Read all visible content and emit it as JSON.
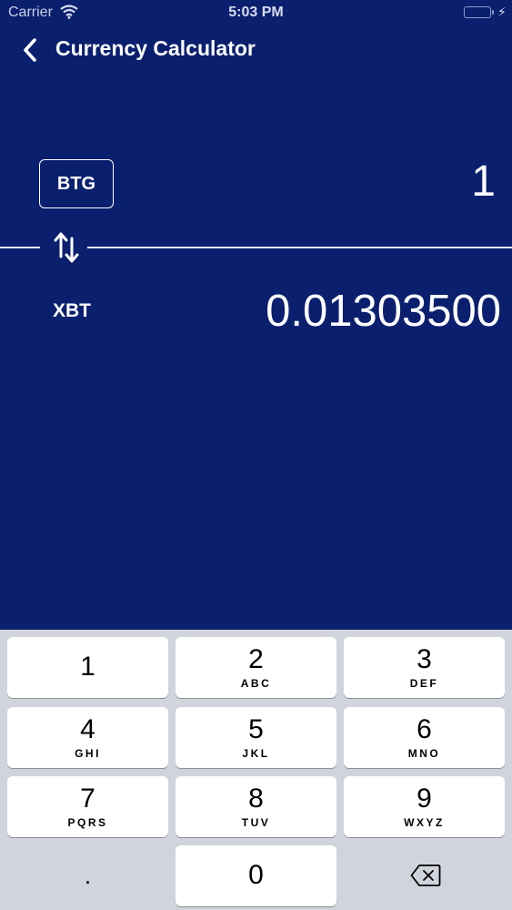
{
  "status_bar": {
    "carrier": "Carrier",
    "time": "5:03 PM",
    "battery_level": 1.0,
    "battery_color": "#4cd964"
  },
  "nav": {
    "title": "Currency Calculator",
    "back_icon": "chevron-left-icon"
  },
  "converter": {
    "from_code": "BTG",
    "from_amount": "1",
    "to_code": "XBT",
    "to_amount": "0.01303500",
    "swap_icon": "swap-arrows-icon"
  },
  "keypad": {
    "keys": [
      {
        "digit": "1",
        "letters": ""
      },
      {
        "digit": "2",
        "letters": "ABC"
      },
      {
        "digit": "3",
        "letters": "DEF"
      },
      {
        "digit": "4",
        "letters": "GHI"
      },
      {
        "digit": "5",
        "letters": "JKL"
      },
      {
        "digit": "6",
        "letters": "MNO"
      },
      {
        "digit": "7",
        "letters": "PQRS"
      },
      {
        "digit": "8",
        "letters": "TUV"
      },
      {
        "digit": "9",
        "letters": "WXYZ"
      }
    ],
    "decimal": ".",
    "zero": "0",
    "delete_icon": "backspace-icon"
  },
  "colors": {
    "background": "#0a1f6e",
    "keyboard": "#d1d4dc",
    "key": "#ffffff"
  }
}
